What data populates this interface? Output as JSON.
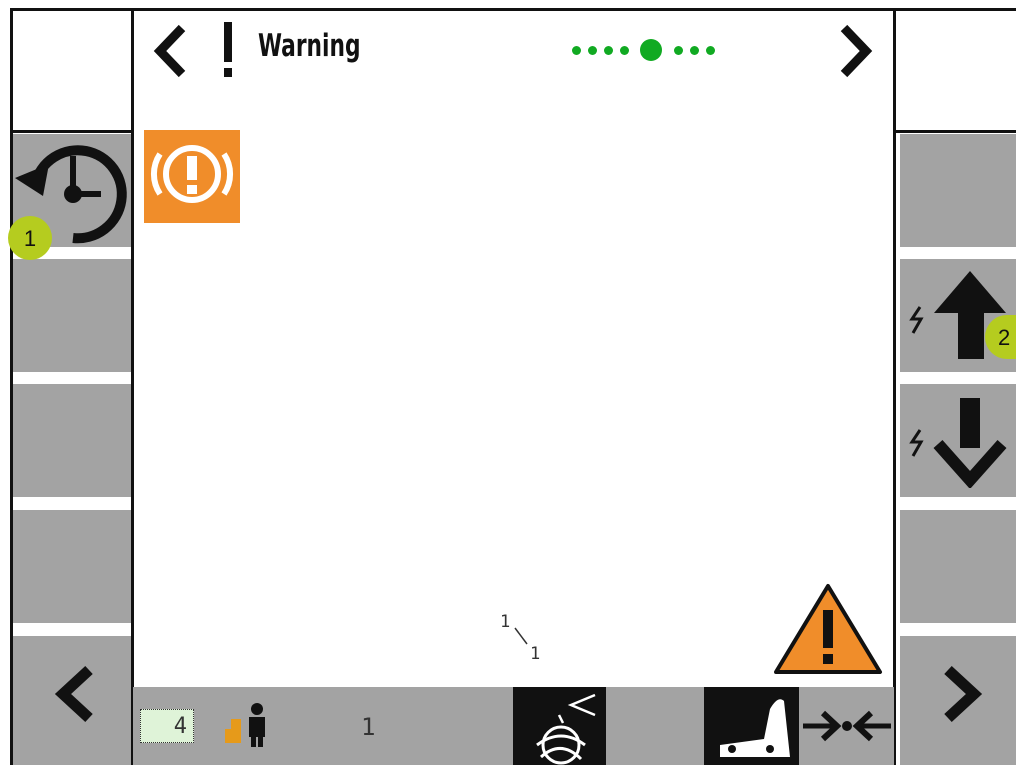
{
  "header": {
    "title": "Warning",
    "prev_label": "<",
    "next_label": ">",
    "page_dots": {
      "count": 8,
      "active_index": 4
    }
  },
  "left_softkeys": [
    {
      "name": "history-reset",
      "icon": "history-reset-icon"
    },
    {
      "name": "empty",
      "icon": ""
    },
    {
      "name": "empty",
      "icon": ""
    },
    {
      "name": "empty",
      "icon": ""
    },
    {
      "name": "page-back",
      "icon": "chevron-left-icon"
    }
  ],
  "right_softkeys": [
    {
      "name": "empty",
      "icon": ""
    },
    {
      "name": "scroll-up",
      "icon": "arrow-up-icon"
    },
    {
      "name": "scroll-down",
      "icon": "arrow-down-icon"
    },
    {
      "name": "empty",
      "icon": ""
    },
    {
      "name": "page-forward",
      "icon": "chevron-right-icon"
    }
  ],
  "callouts": {
    "one": "1",
    "two": "2"
  },
  "content": {
    "alert_icon": "brake-warning-icon",
    "alert_color": "#f08d2a",
    "pager_numerator": "1",
    "pager_denominator": "1",
    "warning_triangle_color": "#f08d2a"
  },
  "statusbar": {
    "counter_value": "4",
    "operator_count": "1",
    "colors": {
      "bar": "#a3a3a3",
      "counter_bg": "#dff3d8",
      "person_accent": "#e69a1a"
    }
  }
}
